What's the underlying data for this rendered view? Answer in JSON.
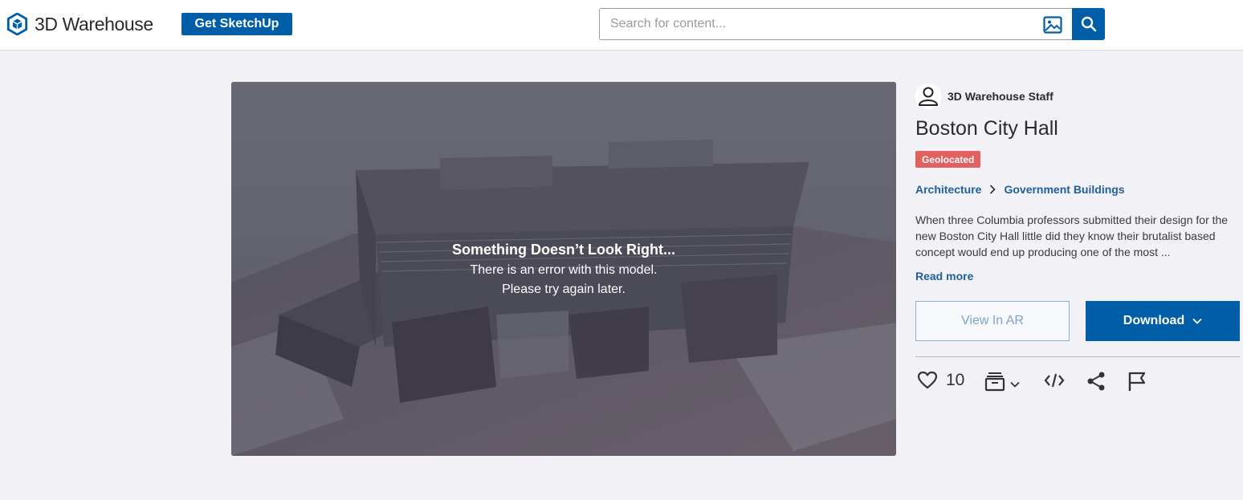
{
  "header": {
    "logo_text": "3D Warehouse",
    "get_sketchup_label": "Get SketchUp",
    "search_placeholder": "Search for content..."
  },
  "viewer": {
    "error_title": "Something Doesn’t Look Right...",
    "error_line1": "There is an error with this model.",
    "error_line2": "Please try again later."
  },
  "model": {
    "author": "3D Warehouse Staff",
    "title": "Boston City Hall",
    "badge": "Geolocated",
    "category": "Architecture",
    "subcategory": "Government Buildings",
    "description": "When three Columbia professors submitted their design for the new Boston City Hall little did they know their brutalist based concept would end up producing one of the most ...",
    "read_more": "Read more",
    "view_ar_label": "View In AR",
    "download_label": "Download",
    "like_count": "10"
  },
  "colors": {
    "brand_blue": "#005ea8",
    "badge_red": "#e0615f",
    "link_blue": "#1f5f9c"
  }
}
